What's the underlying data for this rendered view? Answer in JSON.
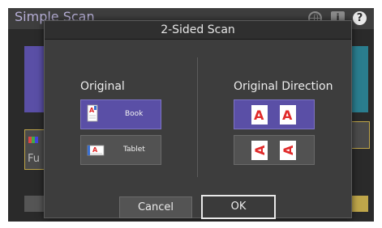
{
  "app": {
    "title": "Simple Scan"
  },
  "topbar": {
    "icons": [
      "globe-icon",
      "info-icon",
      "help-icon"
    ],
    "info_glyph": "i",
    "help_glyph": "?"
  },
  "background": {
    "left_card_label": "Fu"
  },
  "dialog": {
    "title": "2-Sided Scan",
    "original": {
      "heading": "Original",
      "options": [
        {
          "label": "Book",
          "icon": "book-icon",
          "selected": true
        },
        {
          "label": "Tablet",
          "icon": "tablet-icon",
          "selected": false
        }
      ]
    },
    "original_direction": {
      "heading": "Original Direction",
      "options": [
        {
          "icon": "upright-pages-icon",
          "selected": true
        },
        {
          "icon": "sideways-pages-icon",
          "selected": false
        }
      ]
    },
    "buttons": {
      "cancel": "Cancel",
      "ok": "OK"
    }
  },
  "colors": {
    "selected": "#5a4fa6",
    "accent_red": "#e02a2a",
    "dialog_bg": "#3d3d3d"
  }
}
